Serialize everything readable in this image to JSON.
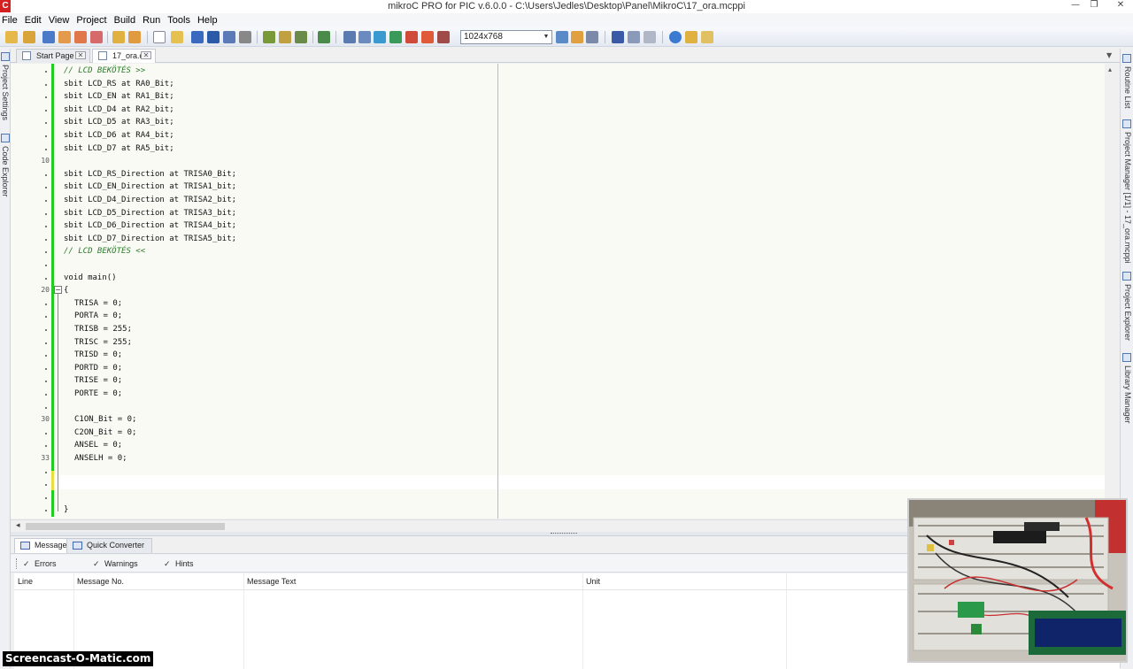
{
  "window": {
    "title": "mikroC PRO for PIC v.6.0.0 - C:\\Users\\Jedles\\Desktop\\Panel\\MikroC\\17_ora.mcppi",
    "icon_letter": "C",
    "controls": {
      "minimize": "—",
      "restore": "❐",
      "close": "✕"
    }
  },
  "menu": [
    {
      "label": "File"
    },
    {
      "label": "Edit"
    },
    {
      "label": "View"
    },
    {
      "label": "Project"
    },
    {
      "label": "Build"
    },
    {
      "label": "Run"
    },
    {
      "label": "Tools"
    },
    {
      "label": "Help"
    }
  ],
  "toolbar": {
    "resolution_value": "1024x768"
  },
  "left_dock": {
    "tabs": [
      "Project Settings",
      "Code Explorer"
    ]
  },
  "right_dock": {
    "tabs": [
      "Routine List",
      "Project Manager [1/1] - 17_ora.mcppi",
      "Project Explorer",
      "Library Manager"
    ]
  },
  "editor_tabs": [
    {
      "label": "Start Page",
      "active": false
    },
    {
      "label": "17_ora.c",
      "active": true
    }
  ],
  "gutter": {
    "numbers": [
      {
        "row": 7,
        "label": "10"
      },
      {
        "row": 17,
        "label": "20"
      },
      {
        "row": 27,
        "label": "30"
      },
      {
        "row": 30,
        "label": "33"
      }
    ]
  },
  "code_lines": [
    {
      "row": 0,
      "indent": 0,
      "text": "// LCD BEKÖTÉS >>",
      "comment": true
    },
    {
      "row": 1,
      "indent": 0,
      "text": "sbit LCD_RS at RA0_Bit;"
    },
    {
      "row": 2,
      "indent": 0,
      "text": "sbit LCD_EN at RA1_Bit;"
    },
    {
      "row": 3,
      "indent": 0,
      "text": "sbit LCD_D4 at RA2_bit;"
    },
    {
      "row": 4,
      "indent": 0,
      "text": "sbit LCD_D5 at RA3_bit;"
    },
    {
      "row": 5,
      "indent": 0,
      "text": "sbit LCD_D6 at RA4_bit;"
    },
    {
      "row": 6,
      "indent": 0,
      "text": "sbit LCD_D7 at RA5_bit;"
    },
    {
      "row": 8,
      "indent": 0,
      "text": "sbit LCD_RS_Direction at TRISA0_Bit;"
    },
    {
      "row": 9,
      "indent": 0,
      "text": "sbit LCD_EN_Direction at TRISA1_bit;"
    },
    {
      "row": 10,
      "indent": 0,
      "text": "sbit LCD_D4_Direction at TRISA2_bit;"
    },
    {
      "row": 11,
      "indent": 0,
      "text": "sbit LCD_D5_Direction at TRISA3_bit;"
    },
    {
      "row": 12,
      "indent": 0,
      "text": "sbit LCD_D6_Direction at TRISA4_bit;"
    },
    {
      "row": 13,
      "indent": 0,
      "text": "sbit LCD_D7_Direction at TRISA5_bit;"
    },
    {
      "row": 14,
      "indent": 0,
      "text": "// LCD BEKÖTÉS <<",
      "comment": true
    },
    {
      "row": 16,
      "indent": 0,
      "text": "void main()"
    },
    {
      "row": 17,
      "indent": 0,
      "text": "{"
    },
    {
      "row": 18,
      "indent": 1,
      "text": "TRISA = 0;"
    },
    {
      "row": 19,
      "indent": 1,
      "text": "PORTA = 0;"
    },
    {
      "row": 20,
      "indent": 1,
      "text": "TRISB = 255;"
    },
    {
      "row": 21,
      "indent": 1,
      "text": "TRISC = 255;"
    },
    {
      "row": 22,
      "indent": 1,
      "text": "TRISD = 0;"
    },
    {
      "row": 23,
      "indent": 1,
      "text": "PORTD = 0;"
    },
    {
      "row": 24,
      "indent": 1,
      "text": "TRISE = 0;"
    },
    {
      "row": 25,
      "indent": 1,
      "text": "PORTE = 0;"
    },
    {
      "row": 27,
      "indent": 1,
      "text": "C1ON_Bit = 0;"
    },
    {
      "row": 28,
      "indent": 1,
      "text": "C2ON_Bit = 0;"
    },
    {
      "row": 29,
      "indent": 1,
      "text": "ANSEL = 0;"
    },
    {
      "row": 30,
      "indent": 1,
      "text": "ANSELH = 0;"
    },
    {
      "row": 34,
      "indent": 0,
      "text": "}"
    }
  ],
  "bottom_panel": {
    "tabs": [
      {
        "label": "Messages",
        "active": true
      },
      {
        "label": "Quick Converter",
        "active": false
      }
    ],
    "filters": [
      {
        "label": "Errors",
        "checked": true
      },
      {
        "label": "Warnings",
        "checked": true
      },
      {
        "label": "Hints",
        "checked": true
      }
    ],
    "columns": [
      "Line",
      "Message No.",
      "Message Text",
      "Unit"
    ],
    "rows": []
  },
  "watermark": "Screencast-O-Matic.com"
}
